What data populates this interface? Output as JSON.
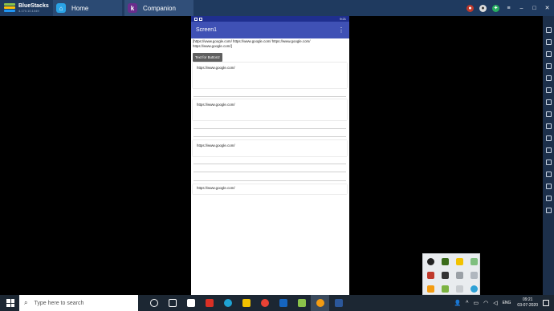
{
  "titlebar": {
    "app_name": "BlueStacks",
    "version": "4.170.10.1049",
    "tabs": [
      {
        "label": "Home"
      },
      {
        "label": "Companion"
      }
    ]
  },
  "device": {
    "status_time": "9:21",
    "screen_title": "Screen1",
    "urls_label": "[https://www.google.com/ https://www.google.com/ https://www.google.com/ https://www.google.com/]",
    "button_label": "Text for Button2",
    "cards": [
      {
        "text": "https://www.google.com/"
      },
      {
        "text": "https://www.google.com/"
      },
      {
        "text": "https://www.google.com/"
      },
      {
        "text": "https://www.google.com/"
      }
    ]
  },
  "taskbar": {
    "search_placeholder": "Type here to search",
    "language": "ENG",
    "time": "09:21",
    "date": "03-07-2020"
  },
  "colors": {
    "app_bar": "#3f51b5",
    "status_bar": "#1f2f8f",
    "bluestacks_title": "#1f3a5f",
    "taskbar": "#1c2733"
  }
}
